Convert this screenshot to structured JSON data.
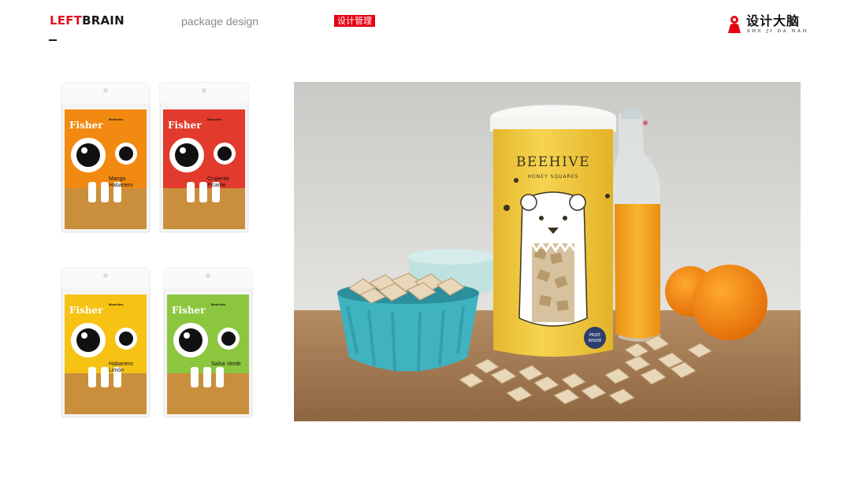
{
  "header": {
    "brand_left": "LEFT",
    "brand_right": "BRAIN",
    "subtitle": "package design",
    "tag": "设计管理",
    "logo_text": "设计大脑",
    "logo_sub": "SHE JI DA NAO"
  },
  "bags": [
    {
      "brand": "Fisher",
      "small": "Munchies",
      "flavor_line1": "Mango",
      "flavor_line2": "Habanero",
      "color": "#f28a12"
    },
    {
      "brand": "Fisher",
      "small": "Munchies",
      "flavor_line1": "Crujiente",
      "flavor_line2": "Picante",
      "color": "#e23a2c"
    },
    {
      "brand": "Fisher",
      "small": "Munchies",
      "flavor_line1": "Habanero",
      "flavor_line2": "Limón",
      "color": "#f6c214"
    },
    {
      "brand": "Fisher",
      "small": "Munchies",
      "flavor_line1": "Salsa Verde",
      "flavor_line2": "",
      "color": "#8cc63f"
    }
  ],
  "beehive": {
    "brand": "BEEHIVE",
    "sub": "HONEY SQUARES",
    "badge_line1": "PRIZE",
    "badge_line2": "INSIDE"
  },
  "colors": {
    "accent_red": "#e60012",
    "brand_red": "#e0101e",
    "tin_yellow": "#f3cc3e",
    "bowl_teal": "#3fb3c0"
  }
}
